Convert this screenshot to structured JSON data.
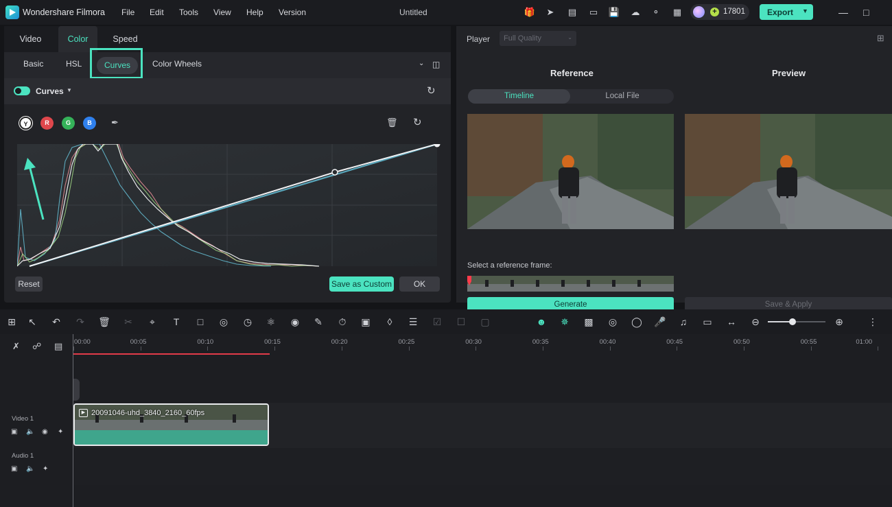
{
  "titlebar": {
    "app_name": "Wondershare Filmora",
    "menu": [
      "File",
      "Edit",
      "Tools",
      "View",
      "Help",
      "Version"
    ],
    "doc_title": "Untitled",
    "credits": "17801",
    "export_label": "Export"
  },
  "left_panel": {
    "tabs": [
      "Video",
      "Color",
      "Speed"
    ],
    "active_tab": "Color",
    "subtabs": [
      "Basic",
      "HSL",
      "Curves",
      "Color Wheels"
    ],
    "active_subtab": "Curves",
    "curves_label": "Curves",
    "channels": [
      "Y",
      "R",
      "G",
      "B"
    ],
    "reset_label": "Reset",
    "save_custom_label": "Save as Custom",
    "ok_label": "OK"
  },
  "player": {
    "label": "Player",
    "quality": "Full Quality",
    "reference_title": "Reference",
    "preview_title": "Preview",
    "segments": [
      "Timeline",
      "Local File"
    ],
    "active_segment": "Timeline",
    "ref_frame_label": "Select a reference frame:",
    "generate_label": "Generate",
    "save_apply_label": "Save & Apply"
  },
  "timeline": {
    "ruler": [
      "00:00",
      "00:05",
      "00:10",
      "00:15",
      "00:20",
      "00:25",
      "00:30",
      "00:35",
      "00:40",
      "00:45",
      "00:50",
      "00:55",
      "01:00"
    ],
    "tracks": [
      "Video 1",
      "Audio 1"
    ],
    "clip_name": "20091046-uhd_3840_2160_60fps"
  },
  "colors": {
    "accent": "#4be3c0",
    "bg": "#1b1c20",
    "panel": "#222327"
  }
}
